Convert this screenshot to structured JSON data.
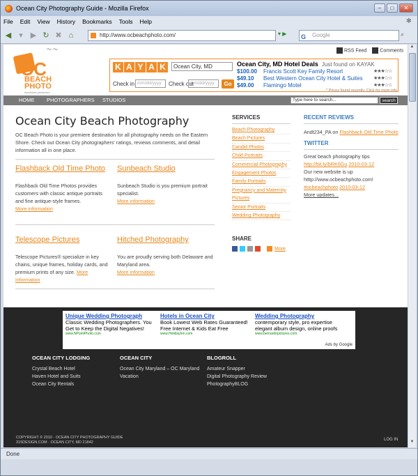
{
  "browser": {
    "title": "Ocean City Photography Guide - Mozilla Firefox",
    "menu": [
      "File",
      "Edit",
      "View",
      "History",
      "Bookmarks",
      "Tools",
      "Help"
    ],
    "url": "http://www.ocbeachphoto.com/",
    "search_placeholder": "Google",
    "status": "Done"
  },
  "site": {
    "logo": {
      "oc": "OC",
      "beach": "BEACH",
      "photo": "PHOTO",
      "tagline": "memories preserved"
    },
    "rss": "RSS Feed",
    "comments": "Comments",
    "nav": [
      "HOME",
      "PHOTOGRAPHERS",
      "STUDIOS"
    ],
    "search_value": "Type here to search...",
    "search_button": "search"
  },
  "kayak": {
    "logo": [
      "K",
      "A",
      "Y",
      "A",
      "K"
    ],
    "location": "Ocean City, MD",
    "checkin_label": "Check in",
    "checkout_label": "Check out",
    "date_placeholder": "mm/dd/yyyy",
    "go": "Go",
    "deals_title": "Ocean City, MD Hotel Deals",
    "deals_sub": "Just found on KAYAK",
    "deals": [
      {
        "price": "$100.00",
        "name": "Francis Scott Key Family Resort",
        "stars": "★★★☆☆"
      },
      {
        "price": "$49.10",
        "name": "Best Western Ocean City Hotel & Suites",
        "stars": "★★★☆☆"
      },
      {
        "price": "$49.00",
        "name": "Flamingo Motel",
        "stars": "★★★☆☆"
      }
    ],
    "footnote": "* Prices found recently. Click for more info"
  },
  "main": {
    "title": "Ocean City Beach Photography",
    "intro": "OC Beach Photo is your premiere destination for all photography needs on the Eastern Shore. Check out Ocean City photographers' ratings, reviews comments, and detail information all in one place.",
    "cards": [
      {
        "title": "Flashback Old Time Photo",
        "desc": "Flashback Old Time Photos provides customers with classic antique portraits and fine antique-style frames.",
        "more": "More information"
      },
      {
        "title": "Sunbeach Studio",
        "desc": "Sunbeach Studio is you premium portrait specialist.",
        "more": "More information"
      },
      {
        "title": "Telescope Pictures",
        "desc": "Telescope Pictures® specialize in key chains, unique frames, holiday cards, and premium prints of any size.",
        "more": "More information"
      },
      {
        "title": "Hitched Photography",
        "desc": "You are proudly serving both Delaware and Maryland area.",
        "more": "More information"
      }
    ]
  },
  "services": {
    "heading": "SERVICES",
    "items": [
      "Beach Photography",
      "Beach Pictures",
      "Candid Photos",
      "Child Portraits",
      "Commercial Photography",
      "Engagement Photos",
      "Family Portraits",
      "Pregnancy and Maternity Pictures",
      "Senior Portraits",
      "Wedding Photography"
    ],
    "share_heading": "SHARE",
    "share_more": "More"
  },
  "reviews": {
    "heading": "RECENT REVIEWS",
    "item_user": "Andt234_PA on ",
    "item_link": "Flashback Old Time Photo",
    "twitter_heading": "TWITTER",
    "tweet1": "Great beach photography tips ",
    "tweet1_link": "http://bit.ly/bRK6Gu",
    "tweet1_date": "2010-03-12",
    "tweet2": "Our new website is up htttp://www.ocbeachphoto.com! ",
    "tweet2_link": "#ocbeachphoto",
    "tweet2_date": "2010-03-12",
    "more": "More updates..."
  },
  "ads": [
    {
      "title": "Unique Wedding Photograph",
      "body": "Classic Wedding Photographers. You Get to Keep the Digital Negatives!",
      "url": "www.NPointPhoto.com"
    },
    {
      "title": "Hotels in Ocean City",
      "body": "Book Lowest Web Rates Guaranteed! Free Internet & Kids Eat Free",
      "url": "www.HolidayInn.com"
    },
    {
      "title": "Wedding Photography",
      "body": "contemporary style, pro expertise elegant album design, online proofs",
      "url": "www.bernardopictures.com"
    }
  ],
  "ads_by": "Ads by Google",
  "footer": {
    "cols": [
      {
        "heading": "OCEAN CITY LODGING",
        "items": [
          "Crystal Beach Hotel",
          "Haven Hotel and Suits",
          "Ocean City Rentals"
        ]
      },
      {
        "heading": "OCEAN CITY",
        "items": [
          "Ocean City Maryland – OC Maryland Vacation"
        ]
      },
      {
        "heading": "BLOGROLL",
        "items": [
          "Amateur Snapper",
          "Digital Photography Review",
          "PhotographyBLOG"
        ]
      }
    ],
    "copyright": "COPYRIGHT © 2010 · OCEAN CITY PHOTOGRAPHY GUIDE",
    "credit": "315DESIGN.COM · OCEAN CITY, MD 21842",
    "login": "LOG IN"
  }
}
